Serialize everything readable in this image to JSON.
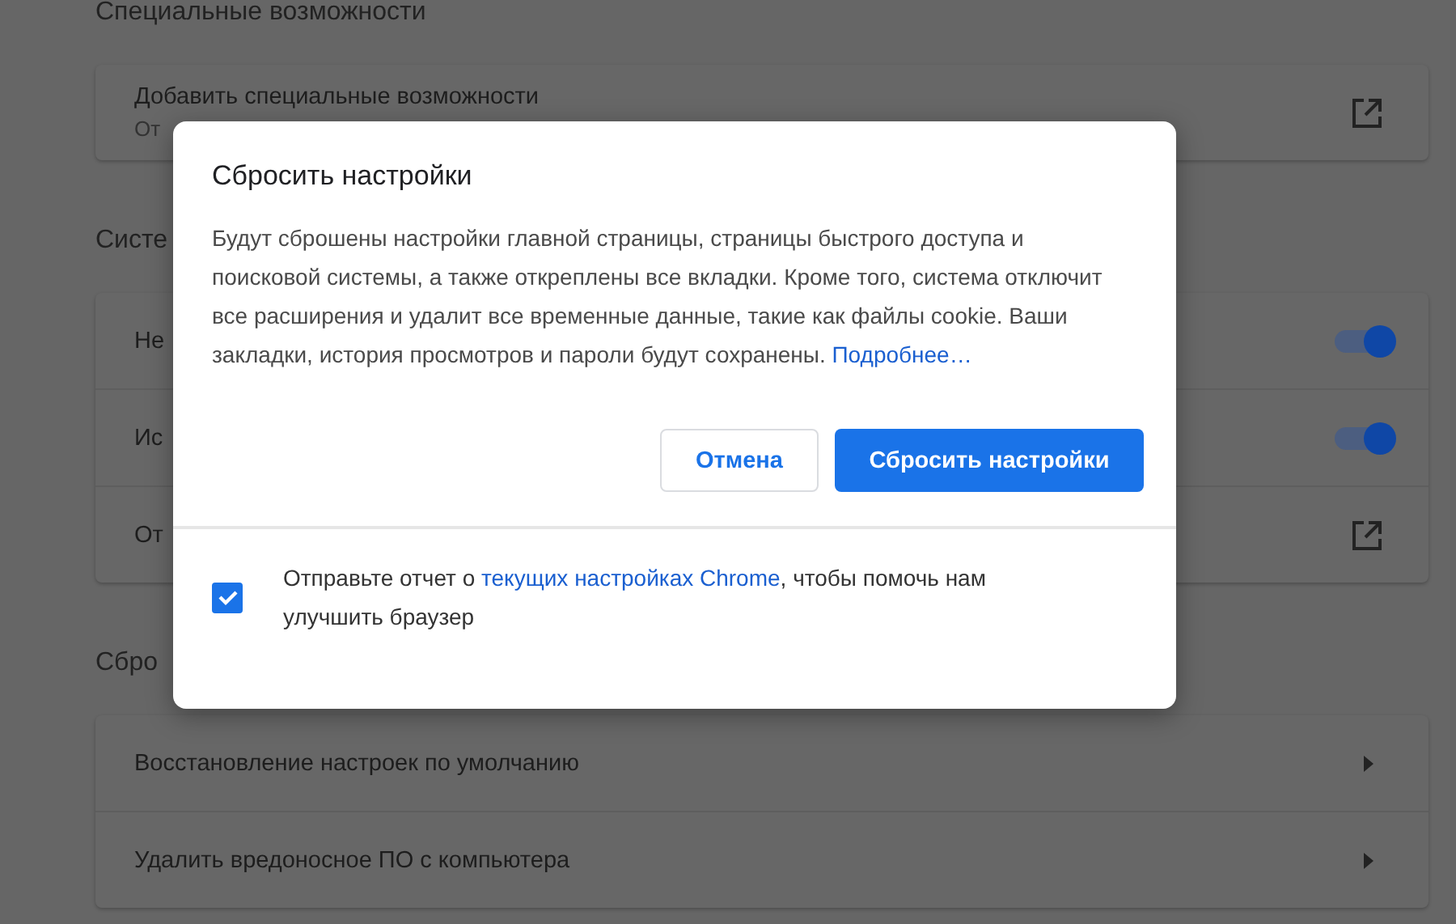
{
  "sections": [
    {
      "title": "Специальные возможности",
      "rows": [
        {
          "kind": "external",
          "title": "Добавить специальные возможности",
          "subtitle": "От"
        }
      ]
    },
    {
      "title": "Систе",
      "rows": [
        {
          "kind": "toggle",
          "title": "Не",
          "on": true
        },
        {
          "kind": "toggle",
          "title": "Ис",
          "on": true
        },
        {
          "kind": "external",
          "title": "От"
        }
      ]
    },
    {
      "title": "Сбро",
      "rows": [
        {
          "kind": "arrow",
          "title": "Восстановление настроек по умолчанию"
        },
        {
          "kind": "arrow",
          "title": "Удалить вредоносное ПО с компьютера"
        }
      ]
    }
  ],
  "dialog": {
    "title": "Сбросить настройки",
    "message": "Будут сброшены настройки главной страницы, страницы быстрого доступа и поисковой системы, а также откреплены все вкладки. Кроме того, система отключит все расширения и удалит все временные данные, такие как файлы cookie. Ваши закладки, история просмотров и пароли будут сохранены.",
    "message_link": "Подробнее…",
    "buttons": [
      {
        "label": "Отмена",
        "kind": "secondary"
      },
      {
        "label": "Сбросить настройки",
        "kind": "primary"
      }
    ],
    "report": {
      "checked": true,
      "text_before": "Отправьте отчет о",
      "link": "текущих настройках Chrome",
      "text_after": ", чтобы помочь нам улучшить браузер"
    }
  }
}
